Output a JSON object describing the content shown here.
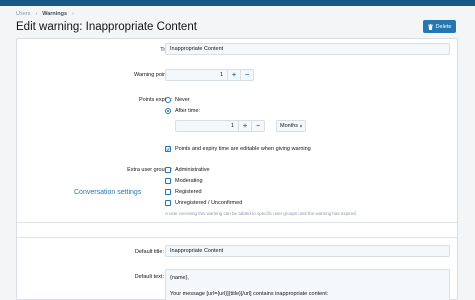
{
  "breadcrumb": {
    "items": [
      "Users",
      "Warnings"
    ],
    "separator": "›"
  },
  "page": {
    "title": "Edit warning: Inappropriate Content"
  },
  "actions": {
    "delete_label": "Delete"
  },
  "form": {
    "title": {
      "label": "Title:",
      "value": "Inappropriate Content"
    },
    "warning_points": {
      "label": "Warning points:",
      "value": "1"
    },
    "points_expiry": {
      "label": "Points expiry:",
      "option_never": "Never",
      "option_after": "After time:",
      "selected": "After time:",
      "amount": "1",
      "unit": "Months"
    },
    "editable_note": {
      "label": "Points and expiry time are editable when giving warning",
      "checked": true
    },
    "extra_groups": {
      "label": "Extra user groups:",
      "options": [
        "Administrative",
        "Moderating",
        "Registered",
        "Unregistered / Unconfirmed"
      ],
      "hint": "A user receiving this warning can be added to specific user groups until the warning has expired."
    }
  },
  "conversation": {
    "section_title": "Conversation settings",
    "default_title": {
      "label": "Default title:",
      "value": "Inappropriate Content"
    },
    "default_text": {
      "label": "Default text:",
      "line1": "{name},",
      "line2": "Your message [url={url}]{title}[/url] contains inappropriate content:"
    }
  },
  "colors": {
    "accent": "#2577b1",
    "topbar": "#185886",
    "panel_bg": "#ffffff",
    "page_bg": "#f3f5f7"
  },
  "icons": {
    "delete": "trash-icon",
    "plus": "plus-icon",
    "minus": "minus-icon",
    "select": "updown-arrow-icon"
  }
}
